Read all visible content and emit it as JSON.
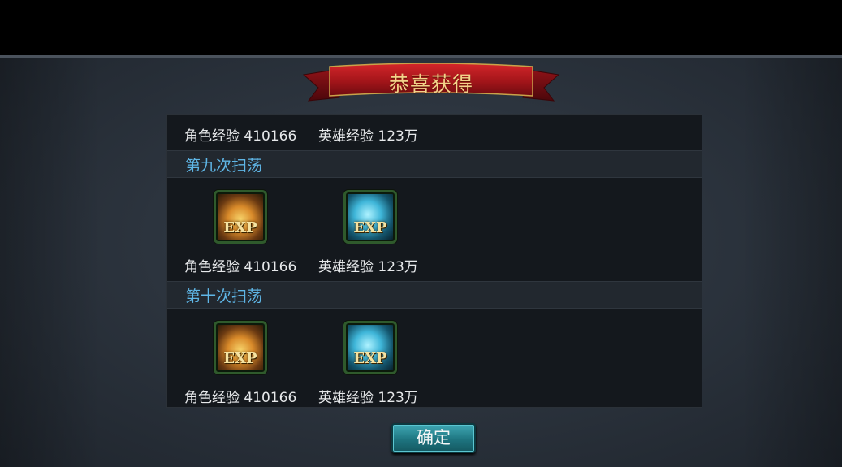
{
  "dialog": {
    "title": "恭喜获得",
    "confirm_label": "确定"
  },
  "summary": {
    "char_exp": "角色经验 410166",
    "hero_exp": "英雄经验 123万"
  },
  "sweeps": [
    {
      "header": "第九次扫荡",
      "rewards": [
        {
          "icon": "exp-gold-icon",
          "icon_text": "EXP",
          "label": "角色经验 410166"
        },
        {
          "icon": "exp-blue-icon",
          "icon_text": "EXP",
          "label": "英雄经验 123万"
        }
      ]
    },
    {
      "header": "第十次扫荡",
      "rewards": [
        {
          "icon": "exp-gold-icon",
          "icon_text": "EXP",
          "label": "角色经验 410166"
        },
        {
          "icon": "exp-blue-icon",
          "icon_text": "EXP",
          "label": "英雄经验 123万"
        }
      ]
    }
  ],
  "colors": {
    "title_text": "#f3d28a",
    "banner_red": "#b0171b",
    "section_header_text": "#5fb6e6",
    "button_teal": "#1e7580"
  }
}
